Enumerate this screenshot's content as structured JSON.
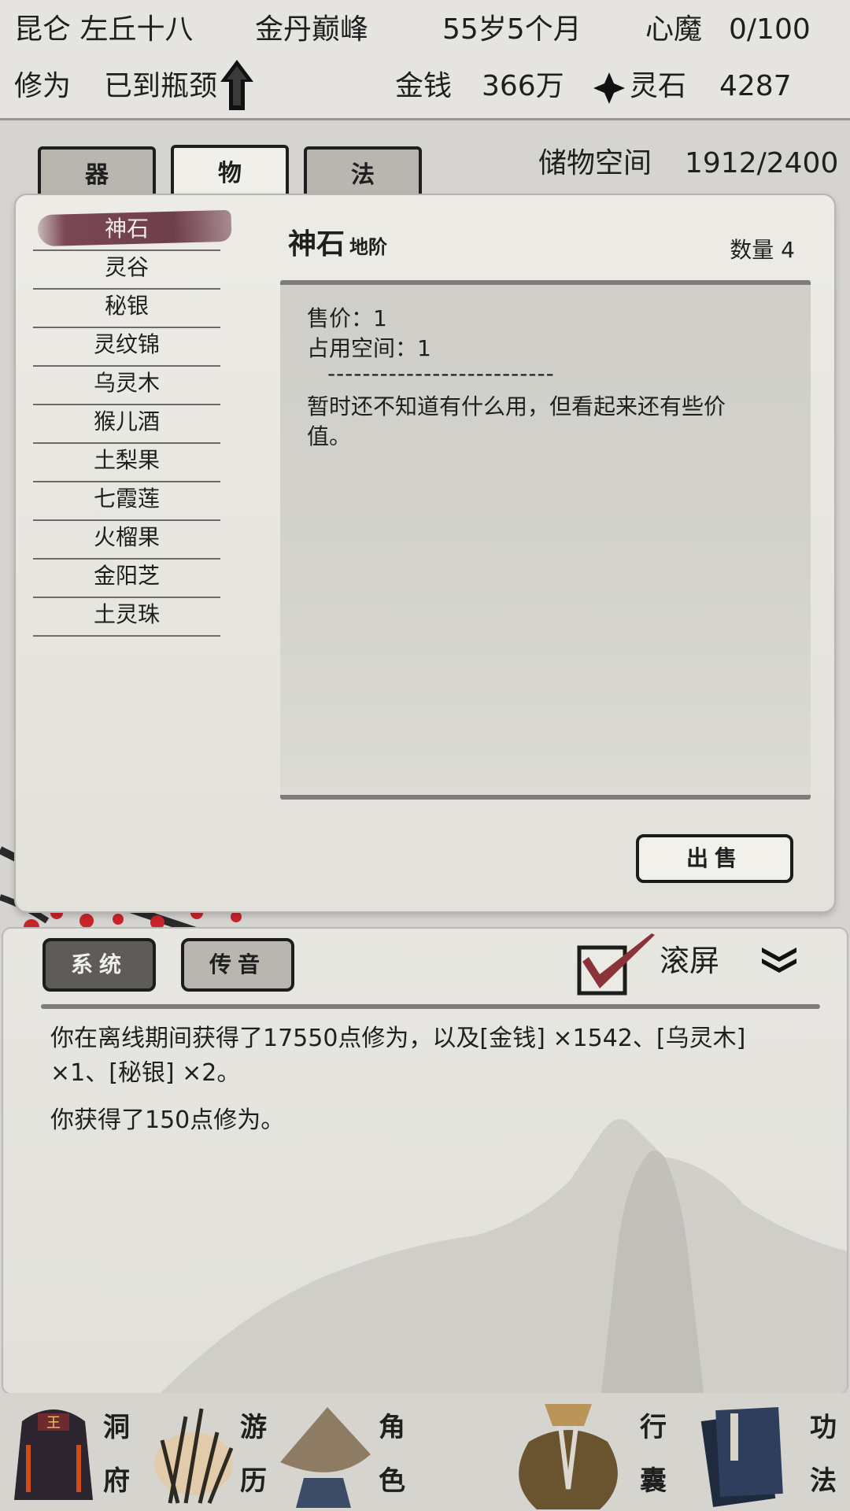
{
  "header": {
    "name": "昆仑 左丘十八",
    "realm": "金丹巅峰",
    "age": "55岁5个月",
    "demon_label": "心魔",
    "demon_value": "0/100",
    "cultivation_label": "修为",
    "cultivation_value": "已到瓶颈",
    "money_label": "金钱",
    "money_value": "366万",
    "spirit_label": "灵石",
    "spirit_value": "4287"
  },
  "tabs": [
    {
      "label": "器"
    },
    {
      "label": "物"
    },
    {
      "label": "法"
    }
  ],
  "storage": {
    "label": "储物空间",
    "value": "1912/2400"
  },
  "items": [
    "神石",
    "灵谷",
    "秘银",
    "灵纹锦",
    "乌灵木",
    "猴儿酒",
    "土梨果",
    "七霞莲",
    "火榴果",
    "金阳芝",
    "土灵珠"
  ],
  "detail": {
    "name": "神石",
    "grade": "地阶",
    "quantity": "数量 4",
    "price": "售价：1",
    "space": "占用空间：1",
    "separator": "--------------------------",
    "description": "暂时还不知道有什么用，但看起来还有些价值。",
    "sell_button": "出售"
  },
  "messages": {
    "tab_system": "系统",
    "tab_voice": "传音",
    "scroll_label": "滚屏",
    "lines": [
      "你在离线期间获得了17550点修为，以及[金钱] ×1542、[乌灵木] ×1、[秘银] ×2。",
      "你获得了150点修为。"
    ]
  },
  "nav": [
    {
      "label_1": "洞",
      "label_2": "府"
    },
    {
      "label_1": "游",
      "label_2": "历"
    },
    {
      "label_1": "角",
      "label_2": "色"
    },
    {
      "label_1": "行",
      "label_2": "囊"
    },
    {
      "label_1": "功",
      "label_2": "法"
    }
  ],
  "colors": {
    "selection": "#7a4754",
    "checkmark": "#8a3338",
    "blossom": "#c8242c"
  }
}
